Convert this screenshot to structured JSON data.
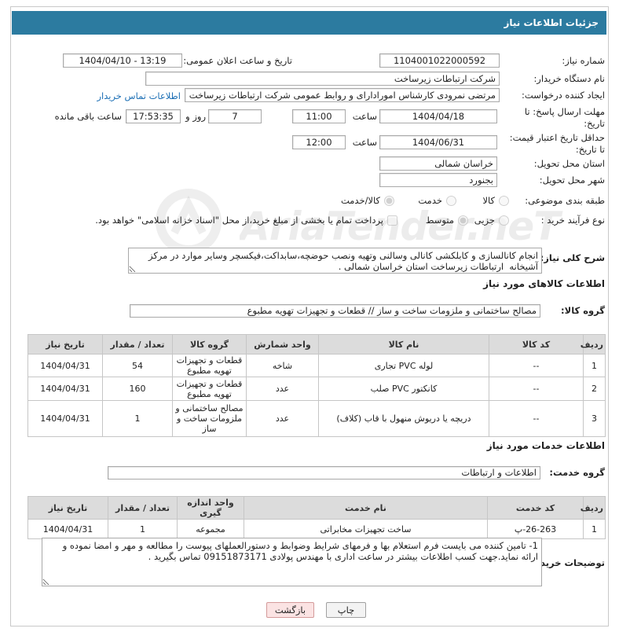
{
  "header": {
    "title": "جزئیات اطلاعات نیاز"
  },
  "watermark": {
    "text": "AriaTender.neT"
  },
  "form": {
    "need_number": {
      "label": "شماره نیاز:",
      "value": "1104001022000592"
    },
    "announce_datetime": {
      "label": "تاریخ و ساعت اعلان عمومی:",
      "value": "1404/04/10 - 13:19"
    },
    "buyer_org": {
      "label": "نام دستگاه خریدار:",
      "value": "شرکت ارتباطات زیرساخت"
    },
    "creator": {
      "label": "ایجاد کننده درخواست:",
      "value": "مرتضی نمرودی کارشناس امورادارای و روابط عمومی شرکت ارتباطات زیرساخت",
      "contact_link": "اطلاعات تماس خریدار"
    },
    "reply_deadline": {
      "label_line1": "مهلت ارسال پاسخ: تا",
      "label_line2": "تاریخ:",
      "date": "1404/04/18",
      "time_label": "ساعت",
      "time": "11:00",
      "days": "7",
      "days_label": "روز و",
      "remaining": "17:53:35",
      "remaining_label": "ساعت باقی مانده"
    },
    "price_validity": {
      "label_line1": "حداقل تاریخ اعتبار قیمت:",
      "label_line2": "تا تاریخ:",
      "date": "1404/06/31",
      "time_label": "ساعت",
      "time": "12:00"
    },
    "province": {
      "label": "استان محل تحویل:",
      "value": "خراسان شمالی"
    },
    "city": {
      "label": "شهر محل تحویل:",
      "value": "بجنورد"
    },
    "category": {
      "label": "طبقه بندی موضوعی:",
      "options": [
        "کالا",
        "خدمت",
        "کالا/خدمت"
      ],
      "selected": "کالا/خدمت"
    },
    "process_type": {
      "label": "نوع فرآیند خرید :",
      "options": [
        "جزیی",
        "متوسط"
      ],
      "selected": "متوسط",
      "treasury_label": "پرداخت تمام یا بخشی از مبلغ خرید،از محل \"اسناد خزانه اسلامی\" خواهد بود.",
      "treasury_checked": false
    },
    "description": {
      "label": "شرح کلی نیاز:",
      "value": "انجام کانالسازی و کابلکشی کانالی وسالنی وتهیه ونصب حوضچه،سابداکت،فیکسچر وسایر موارد در مرکز آشیخانه  ارتباطات زیرساخت استان خراسان شمالی ."
    }
  },
  "goods": {
    "title": "اطلاعات کالاهای مورد نیاز",
    "group_label": "گروه کالا:",
    "group_value": "مصالح ساختمانی و ملزومات ساخت و ساز //  قطعات و تجهیزات تهویه مطبوع",
    "columns": [
      "ردیف",
      "کد کالا",
      "نام کالا",
      "واحد شمارش",
      "گروه کالا",
      "تعداد / مقدار",
      "تاریخ نیاز"
    ],
    "rows": [
      [
        "1",
        "--",
        "لوله PVC تجاری",
        "شاخه",
        "قطعات و تجهیزات تهویه مطبوع",
        "54",
        "1404/04/31"
      ],
      [
        "2",
        "--",
        "کانکتور PVC صلب",
        "عدد",
        "قطعات و تجهیزات تهویه مطبوع",
        "160",
        "1404/04/31"
      ],
      [
        "3",
        "--",
        "دریچه یا دریوش منهول با قاب (کلاف)",
        "عدد",
        "مصالح ساختمانی و ملزومات ساخت و ساز",
        "1",
        "1404/04/31"
      ]
    ]
  },
  "services": {
    "title": "اطلاعات خدمات مورد نیاز",
    "group_label": "گروه خدمت:",
    "group_value": "اطلاعات و ارتباطات",
    "columns": [
      "ردیف",
      "کد خدمت",
      "نام خدمت",
      "واحد اندازه گیری",
      "تعداد / مقدار",
      "تاریخ نیاز"
    ],
    "rows": [
      [
        "1",
        "پ-26-263",
        "ساخت تجهیزات مخابراتی",
        "مجموعه",
        "1",
        "1404/04/31"
      ]
    ]
  },
  "buyer_notes": {
    "label": "توضیحات خریدار:",
    "value": "1- تامین کننده می بایست فرم استعلام بها و فرمهای شرایط وضوابط و دستورالعملهای پیوست را مطالعه و مهر و امضا نموده و ارائه نماید.جهت کسب اطلاعات بیشتر در ساعت اداری با مهندس پولادی 09151873171 تماس بگیرید ."
  },
  "buttons": {
    "print": "چاپ",
    "back": "بازگشت"
  }
}
